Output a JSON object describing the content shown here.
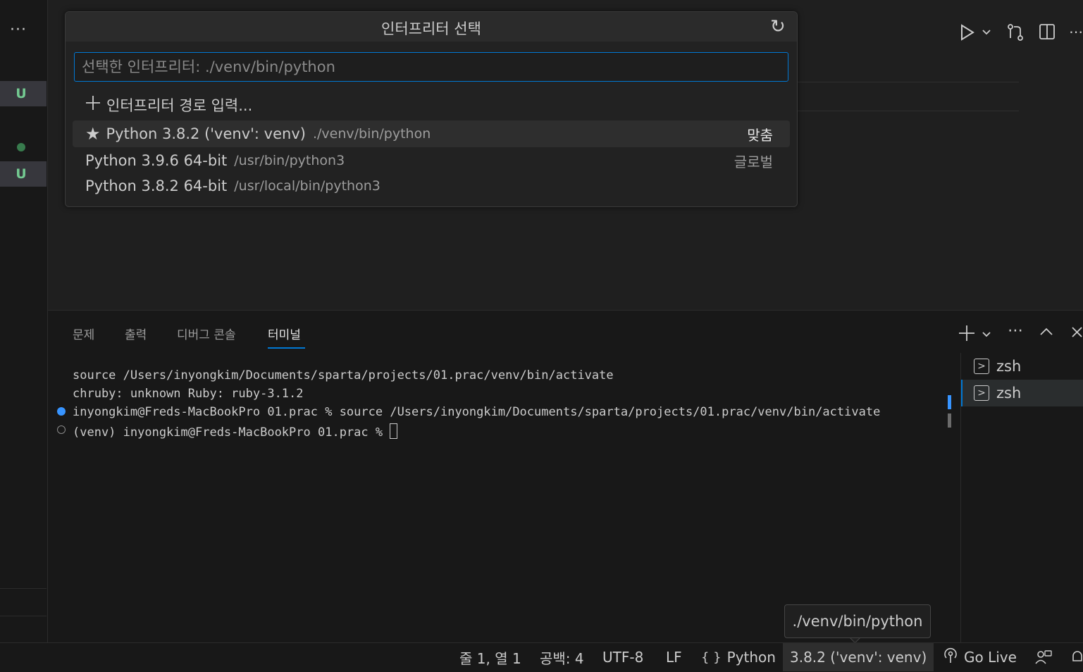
{
  "sidebar": {
    "more_label": "···",
    "badges": [
      "U",
      "U"
    ]
  },
  "editor_toolbar": {
    "icons": [
      "run-icon",
      "chevron-down-icon",
      "source-control-icon",
      "split-editor-icon",
      "more-icon"
    ]
  },
  "quick_pick": {
    "title": "인터프리터 선택",
    "refresh_icon": "↻",
    "input_placeholder": "선택한 인터프리터: ./venv/bin/python",
    "enter_path_label": "인터프리터 경로 입력...",
    "items": [
      {
        "label": "Python 3.8.2 ('venv': venv)",
        "description": "./venv/bin/python",
        "detail": "맞춤",
        "starred": true
      },
      {
        "label": "Python 3.9.6 64-bit",
        "description": "/usr/bin/python3",
        "detail": "글로벌",
        "starred": false
      },
      {
        "label": "Python 3.8.2 64-bit",
        "description": "/usr/local/bin/python3",
        "detail": "",
        "starred": false
      }
    ]
  },
  "panel": {
    "tabs": [
      "문제",
      "출력",
      "디버그 콘솔",
      "터미널"
    ],
    "active_tab": "터미널",
    "terminal_lines": [
      "source /Users/inyongkim/Documents/sparta/projects/01.prac/venv/bin/activate",
      "chruby: unknown Ruby: ruby-3.1.2",
      "inyongkim@Freds-MacBookPro 01.prac % source /Users/inyongkim/Documents/sparta/projects/01.prac/venv/bin/activate",
      "(venv) inyongkim@Freds-MacBookPro 01.prac % "
    ],
    "terminals": [
      "zsh",
      "zsh"
    ]
  },
  "tooltip": "./venv/bin/python",
  "status_bar": {
    "position": "줄 1, 열 1",
    "spaces": "공백: 4",
    "encoding": "UTF-8",
    "eol": "LF",
    "language": "Python",
    "interpreter": "3.8.2 ('venv': venv)",
    "go_live": "Go Live"
  },
  "colors": {
    "accent": "#0078d4",
    "git_untracked": "#73c991"
  }
}
